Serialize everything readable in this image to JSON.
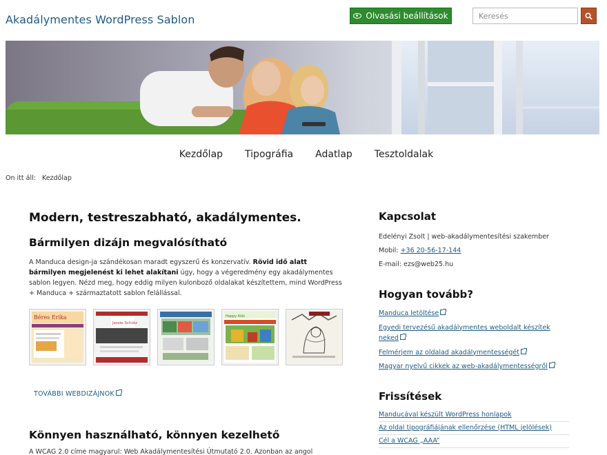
{
  "header": {
    "site_title": "Akadálymentes WordPress Sablon",
    "reading_settings_label": "Olvasási beállítások",
    "search_placeholder": "Keresés"
  },
  "nav": {
    "items": [
      {
        "label": "Kezdőlap"
      },
      {
        "label": "Tipográfia"
      },
      {
        "label": "Adatlap"
      },
      {
        "label": "Tesztoldalak"
      }
    ]
  },
  "breadcrumb": {
    "prefix": "On itt áll:",
    "current": "Kezdőlap"
  },
  "main": {
    "headline": "Modern, testreszabható, akadálymentes.",
    "section1_title": "Bármilyen dizájn megvalósítható",
    "section1_text_a": "A Manduca design-ja szándékosan maradt egyszerű és konzervatív. ",
    "section1_text_bold": "Rövid idő alatt bármilyen megjelenést ki lehet alakítani",
    "section1_text_b": " úgy, hogy a végeredmény egy akadálymentes sablon legyen",
    "section1_text_c": ". Nézd meg, hogy eddig milyen kulonboző oldalakat készítettem, mind WordPress + Manduca + származtatott sablon felállással.",
    "thumb_labels": [
      "Béres Erika",
      "Jessie Schütz",
      "",
      "Happy Kids",
      ""
    ],
    "more_designs_link": "TOVÁBBI WEBDIZÁJNOK",
    "section2_title": "Könnyen használható, könnyen kezelhető",
    "section2_text": "A WCAG 2.0 címe magyarul: Web Akadálymentesítési Útmutató 2.0. Azonban az angol"
  },
  "sidebar": {
    "contact_title": "Kapcsolat",
    "contact_name": "Edelényi Zsolt | web-akadálymentesítési szakember",
    "mobile_label": "Mobil:",
    "mobile_value": "+36 20-56-17-144",
    "email_label": "E-mail:",
    "email_value": "ezs@web25.hu",
    "next_title": "Hogyan tovább?",
    "next_links": [
      "Manduca letöltése",
      "Egyedi tervezésű akadálymentes weboldalt készítek neked",
      "Felmérjem az oldalad akadálymentességét",
      "Magyar nyelvű cikkek az web-akadálymentességről"
    ],
    "updates_title": "Frissítések",
    "updates": [
      "Manducával készült WordPress honlapok",
      "Az oldal tipográfiájának ellenőrzése (HTML jelölések)",
      "Cél a WCAG „AAA”"
    ]
  },
  "colors": {
    "title": "#1f5a86",
    "read_button": "#2e8b2e",
    "search_button": "#b4532a",
    "link": "#1f5a86"
  }
}
